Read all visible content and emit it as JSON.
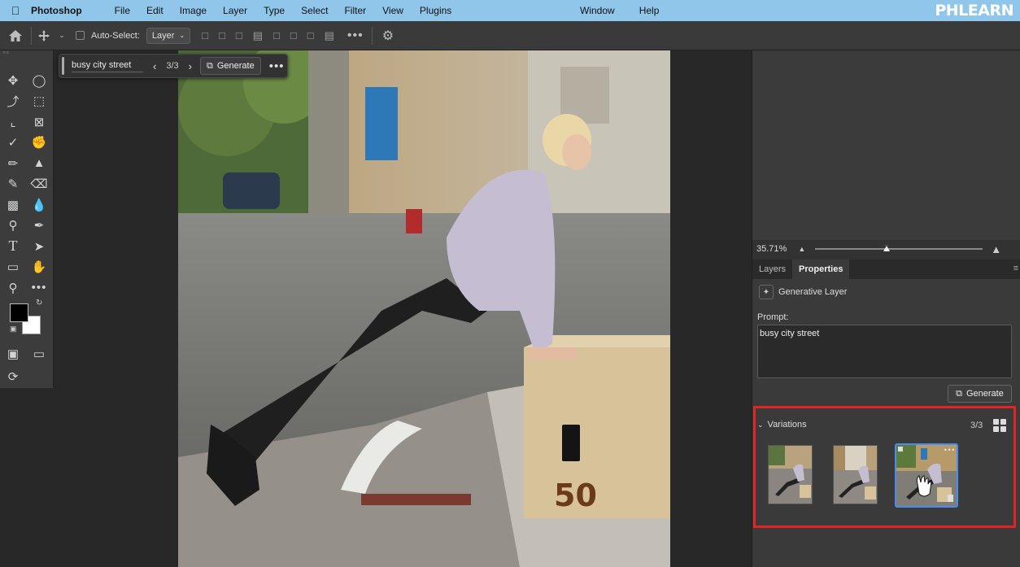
{
  "menubar": {
    "apple": "",
    "app": "Photoshop",
    "items": [
      "File",
      "Edit",
      "Image",
      "Layer",
      "Type",
      "Select",
      "Filter",
      "View",
      "Plugins"
    ],
    "right_items": [
      "Window",
      "Help"
    ],
    "brand": "PHLEARN"
  },
  "options": {
    "auto_select_label": "Auto-Select:",
    "auto_select_value": "Layer"
  },
  "taskbar": {
    "prompt": "busy city street",
    "count": "3/3",
    "generate_label": "Generate"
  },
  "navigator": {
    "zoom": "35.71%"
  },
  "panel": {
    "tabs": [
      "Layers",
      "Properties"
    ],
    "active_tab": "Properties",
    "layer_type": "Generative Layer",
    "prompt_label": "Prompt:",
    "prompt_value": "busy city street",
    "generate_label": "Generate",
    "variations_label": "Variations",
    "variations_count": "3/3"
  },
  "colors": {
    "highlight": "#e22424",
    "selection": "#4a8cf0",
    "menubar": "#8fc6ea"
  },
  "photo_text": {
    "box_number": "50"
  }
}
